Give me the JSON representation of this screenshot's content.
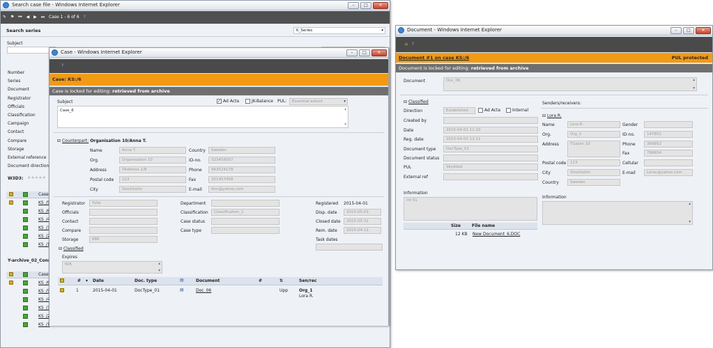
{
  "search_window": {
    "title": "Search case file - Windows Internet Explorer",
    "case_counter": "Case 1 - 6 of 6",
    "search_series_label": "Search series",
    "series_select": "K_Series",
    "subject_label": "Subject",
    "fields": [
      "Number",
      "Series",
      "Document",
      "Registrator",
      "Officials",
      "Classification",
      "Campaign",
      "Contact",
      "Compare",
      "Storage",
      "External reference",
      "Document direction"
    ],
    "w3d3_label": "W3D3:",
    "case_header": "Case",
    "group1": [
      "KS_/5",
      "KS_/6",
      "KS_/4",
      "KS_/3",
      "KS_/2",
      "KS_/1"
    ],
    "archive_label": "Y-archive_02_Conn",
    "group2": [
      "KS_/6",
      "KS_/5",
      "KS_/4",
      "KS_/3",
      "KS_/2",
      "KS_/1"
    ]
  },
  "case_window": {
    "title": "Case - Windows Internet Explorer",
    "case_header": "Case: KS:/6",
    "lock_prefix": "Case is locked for editing:",
    "lock_reason": "retrieved from archive",
    "subject_label": "Subject",
    "subject_value": "Case_6",
    "ad_acta": "Ad Acta",
    "jk_balance": "JK-Balance",
    "pul_label": "PUL:",
    "pul_value": "Essential extent",
    "counterpart_label": "Counterpart:",
    "counterpart_value": "Organisation 10/Anna T.",
    "cp": {
      "name_l": "Name",
      "name_v": "Anna T.",
      "org_l": "Org.",
      "org_v": "Organisation 10",
      "addr_l": "Address",
      "addr_v": "TAddress 1/8",
      "pc_l": "Postal code",
      "pc_v": "123",
      "city_l": "City",
      "city_v": "Stockholm",
      "country_l": "Country",
      "country_v": "Sweden",
      "id_l": "ID-no.",
      "id_v": "323456007",
      "phone_l": "Phone",
      "phone_v": "963524178",
      "fax_l": "Fax",
      "fax_v": "321457458",
      "email_l": "E-mail",
      "email_v": "Ann@yahoo.com"
    },
    "reg": {
      "registrator_l": "Registrator",
      "registrator_v": "Yulia",
      "officials_l": "Officials",
      "contact_l": "Contact",
      "compare_l": "Compare",
      "storage_l": "Storage",
      "storage_v": "888",
      "department_l": "Department",
      "classification_l": "Classification",
      "classification_v": "Classification_1",
      "case_status_l": "Case status",
      "case_type_l": "Case type",
      "registered_l": "Registered",
      "registered_v": "2015-04-01",
      "disp_l": "Disp. date",
      "disp_v": "2015-05-01",
      "closed_l": "Closed date",
      "closed_v": "2015-05-31",
      "rem_l": "Rem. date",
      "rem_v": "2015-04-11",
      "task_l": "Task dates"
    },
    "classified_label": "Classified",
    "expires_label": "Expires",
    "expires_value": "N/A",
    "table_headers": [
      "#",
      "Date",
      "Doc. type",
      "Document",
      "Sen/rec"
    ],
    "row": {
      "num": "1",
      "date": "2015-04-01",
      "doctype": "DocType_01",
      "doc": "Doc_06",
      "dir": "Upp",
      "org": "Org_1",
      "person": "Lora R."
    }
  },
  "document_window": {
    "title": "Document - Windows Internet Explorer",
    "header_left": "Document #1 on case KS:/6",
    "header_right": "PUL protected",
    "lock_prefix": "Document is locked for editing:",
    "lock_reason": "retrieved from archive",
    "document_label": "Document",
    "document_value": "Doc_06",
    "classified_label": "Classified",
    "direction_label": "Direction",
    "direction_value": "Established",
    "ad_acta": "Ad Acta",
    "internal": "Internal",
    "created_by_label": "Created by",
    "date_label": "Date",
    "date_value": "2015-04-01 11:10",
    "reg_date_label": "Reg. date",
    "reg_date_value": "2015-04-01 11:11",
    "doc_type_label": "Document type",
    "doc_type_value": "DocType_01",
    "doc_status_label": "Document status",
    "pul_label": "PUL",
    "pul_value": "Skyddad",
    "external_ref_label": "External ref",
    "information_label": "Information",
    "information_value": "inf 01",
    "file_size_header": "Size",
    "file_name_header": "File name",
    "file_size": "12 KB",
    "file_name": "New Document_6.DOC",
    "senders_label": "Senders/receivers:",
    "sender_name": "Lora R.",
    "sr": {
      "name_l": "Name",
      "name_v": "Lora R.",
      "org_l": "Org.",
      "org_v": "Org_1",
      "addr_l": "Address",
      "addr_v": "TGatan 10",
      "pc_l": "Postal code",
      "pc_v": "123",
      "city_l": "City",
      "city_v": "Stockholm",
      "country_l": "Country",
      "country_v": "Sweden",
      "gender_l": "Gender",
      "id_l": "ID-no.",
      "id_v": "147852",
      "phone_l": "Phone",
      "phone_v": "369852",
      "fax_l": "Fax",
      "fax_v": "789654",
      "cell_l": "Cellular",
      "email_l": "E-mail",
      "email_v": "Lorac@yahoo.com"
    },
    "sr_information_label": "Information"
  }
}
